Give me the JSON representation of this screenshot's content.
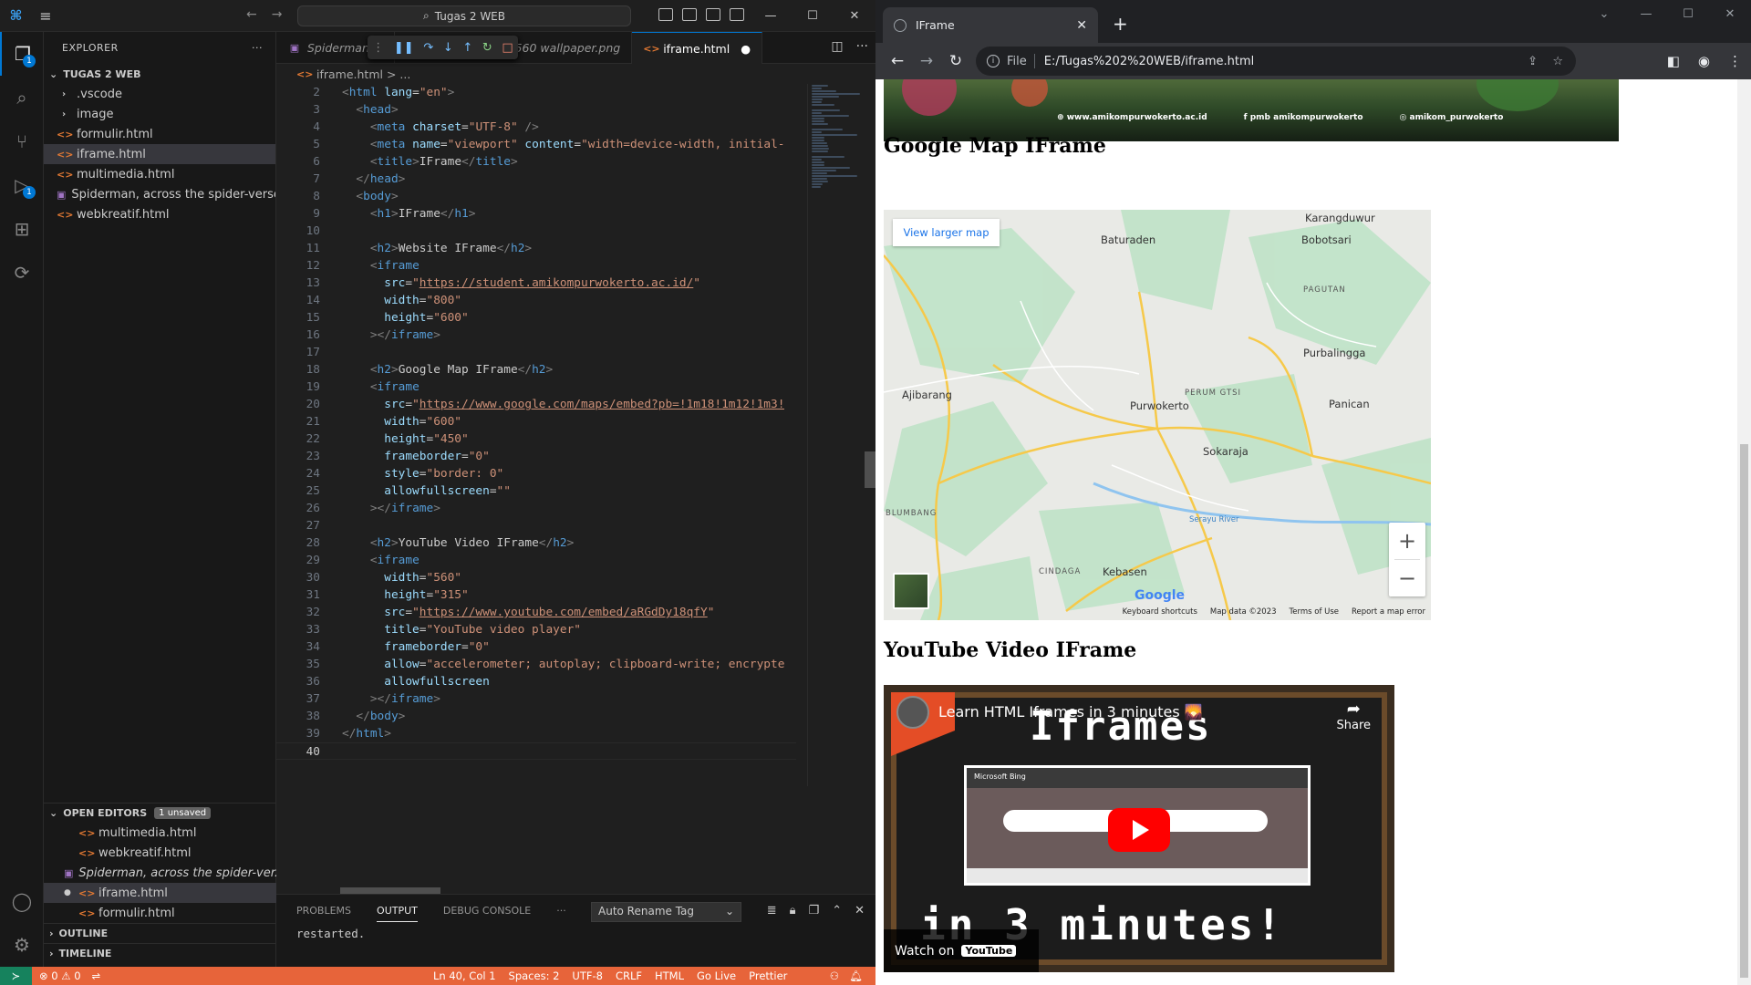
{
  "vscode": {
    "search": "Tugas 2 WEB",
    "explorer_title": "EXPLORER",
    "folder": "TUGAS 2 WEB",
    "files": [
      {
        "name": ".vscode",
        "type": "folder"
      },
      {
        "name": "image",
        "type": "folder"
      },
      {
        "name": "formulir.html",
        "type": "html"
      },
      {
        "name": "iframe.html",
        "type": "html"
      },
      {
        "name": "multimedia.html",
        "type": "html"
      },
      {
        "name": "Spiderman, across the spider-verse,...",
        "type": "png"
      },
      {
        "name": "webkreatif.html",
        "type": "html"
      }
    ],
    "open_editors": {
      "title": "OPEN EDITORS",
      "badge": "1 unsaved",
      "items": [
        "multimedia.html",
        "webkreatif.html",
        "Spiderman, across the spider-ver...",
        "iframe.html",
        "formulir.html"
      ]
    },
    "outline": "OUTLINE",
    "timeline": "TIMELINE",
    "tabs": [
      {
        "label": "Spiderman, a"
      },
      {
        "label": "rale, 1440x2560 wallpaper.png"
      },
      {
        "label": "iframe.html"
      }
    ],
    "breadcrumb": "iframe.html > ...",
    "code_lines": [
      {
        "n": "2",
        "html": "<span class='t-br'>&lt;</span><span class='t-tag'>html</span> <span class='t-attr'>lang</span>=<span class='t-str'>\"en\"</span><span class='t-br'>&gt;</span>"
      },
      {
        "n": "3",
        "html": "  <span class='t-br'>&lt;</span><span class='t-tag'>head</span><span class='t-br'>&gt;</span>"
      },
      {
        "n": "4",
        "html": "    <span class='t-br'>&lt;</span><span class='t-tag'>meta</span> <span class='t-attr'>charset</span>=<span class='t-str'>\"UTF-8\"</span> <span class='t-br'>/&gt;</span>"
      },
      {
        "n": "5",
        "html": "    <span class='t-br'>&lt;</span><span class='t-tag'>meta</span> <span class='t-attr'>name</span>=<span class='t-str'>\"viewport\"</span> <span class='t-attr'>content</span>=<span class='t-str'>\"width=device-width, initial-</span>"
      },
      {
        "n": "6",
        "html": "    <span class='t-br'>&lt;</span><span class='t-tag'>title</span><span class='t-br'>&gt;</span>IFrame<span class='t-br'>&lt;/</span><span class='t-tag'>title</span><span class='t-br'>&gt;</span>"
      },
      {
        "n": "7",
        "html": "  <span class='t-br'>&lt;/</span><span class='t-tag'>head</span><span class='t-br'>&gt;</span>"
      },
      {
        "n": "8",
        "html": "  <span class='t-br'>&lt;</span><span class='t-tag'>body</span><span class='t-br'>&gt;</span>"
      },
      {
        "n": "9",
        "html": "    <span class='t-br'>&lt;</span><span class='t-tag'>h1</span><span class='t-br'>&gt;</span>IFrame<span class='t-br'>&lt;/</span><span class='t-tag'>h1</span><span class='t-br'>&gt;</span>"
      },
      {
        "n": "10",
        "html": ""
      },
      {
        "n": "11",
        "html": "    <span class='t-br'>&lt;</span><span class='t-tag'>h2</span><span class='t-br'>&gt;</span>Website IFrame<span class='t-br'>&lt;/</span><span class='t-tag'>h2</span><span class='t-br'>&gt;</span>"
      },
      {
        "n": "12",
        "html": "    <span class='t-br'>&lt;</span><span class='t-tag'>iframe</span>"
      },
      {
        "n": "13",
        "html": "      <span class='t-attr'>src</span>=<span class='t-str'>\"</span><span class='t-url'>https://student.amikompurwokerto.ac.id/</span><span class='t-str'>\"</span>"
      },
      {
        "n": "14",
        "html": "      <span class='t-attr'>width</span>=<span class='t-str'>\"800\"</span>"
      },
      {
        "n": "15",
        "html": "      <span class='t-attr'>height</span>=<span class='t-str'>\"600\"</span>"
      },
      {
        "n": "16",
        "html": "    <span class='t-br'>&gt;&lt;/</span><span class='t-tag'>iframe</span><span class='t-br'>&gt;</span>"
      },
      {
        "n": "17",
        "html": ""
      },
      {
        "n": "18",
        "html": "    <span class='t-br'>&lt;</span><span class='t-tag'>h2</span><span class='t-br'>&gt;</span>Google Map IFrame<span class='t-br'>&lt;/</span><span class='t-tag'>h2</span><span class='t-br'>&gt;</span>"
      },
      {
        "n": "19",
        "html": "    <span class='t-br'>&lt;</span><span class='t-tag'>iframe</span>"
      },
      {
        "n": "20",
        "html": "      <span class='t-attr'>src</span>=<span class='t-str'>\"</span><span class='t-url'>https://www.google.com/maps/embed?pb=!1m18!1m12!1m3!</span>"
      },
      {
        "n": "21",
        "html": "      <span class='t-attr'>width</span>=<span class='t-str'>\"600\"</span>"
      },
      {
        "n": "22",
        "html": "      <span class='t-attr'>height</span>=<span class='t-str'>\"450\"</span>"
      },
      {
        "n": "23",
        "html": "      <span class='t-attr'>frameborder</span>=<span class='t-str'>\"0\"</span>"
      },
      {
        "n": "24",
        "html": "      <span class='t-attr'>style</span>=<span class='t-str'>\"border: 0\"</span>"
      },
      {
        "n": "25",
        "html": "      <span class='t-attr'>allowfullscreen</span>=<span class='t-str'>\"\"</span>"
      },
      {
        "n": "26",
        "html": "    <span class='t-br'>&gt;&lt;/</span><span class='t-tag'>iframe</span><span class='t-br'>&gt;</span>"
      },
      {
        "n": "27",
        "html": ""
      },
      {
        "n": "28",
        "html": "    <span class='t-br'>&lt;</span><span class='t-tag'>h2</span><span class='t-br'>&gt;</span>YouTube Video IFrame<span class='t-br'>&lt;/</span><span class='t-tag'>h2</span><span class='t-br'>&gt;</span>"
      },
      {
        "n": "29",
        "html": "    <span class='t-br'>&lt;</span><span class='t-tag'>iframe</span>"
      },
      {
        "n": "30",
        "html": "      <span class='t-attr'>width</span>=<span class='t-str'>\"560\"</span>"
      },
      {
        "n": "31",
        "html": "      <span class='t-attr'>height</span>=<span class='t-str'>\"315\"</span>"
      },
      {
        "n": "32",
        "html": "      <span class='t-attr'>src</span>=<span class='t-str'>\"</span><span class='t-url'>https://www.youtube.com/embed/aRGdDy18qfY</span><span class='t-str'>\"</span>"
      },
      {
        "n": "33",
        "html": "      <span class='t-attr'>title</span>=<span class='t-str'>\"YouTube video player\"</span>"
      },
      {
        "n": "34",
        "html": "      <span class='t-attr'>frameborder</span>=<span class='t-str'>\"0\"</span>"
      },
      {
        "n": "35",
        "html": "      <span class='t-attr'>allow</span>=<span class='t-str'>\"accelerometer; autoplay; clipboard-write; encrypte</span>"
      },
      {
        "n": "36",
        "html": "      <span class='t-attr'>allowfullscreen</span>"
      },
      {
        "n": "37",
        "html": "    <span class='t-br'>&gt;&lt;/</span><span class='t-tag'>iframe</span><span class='t-br'>&gt;</span>"
      },
      {
        "n": "38",
        "html": "  <span class='t-br'>&lt;/</span><span class='t-tag'>body</span><span class='t-br'>&gt;</span>"
      },
      {
        "n": "39",
        "html": "<span class='t-br'>&lt;/</span><span class='t-tag'>html</span><span class='t-br'>&gt;</span>"
      },
      {
        "n": "40",
        "html": ""
      }
    ],
    "panel": {
      "tabs": [
        "PROBLEMS",
        "OUTPUT",
        "DEBUG CONSOLE",
        "···"
      ],
      "select": "Auto Rename Tag",
      "output": "restarted."
    },
    "status": {
      "errors": "⊗ 0 ⚠ 0",
      "items": [
        "Ln 40, Col 1",
        "Spaces: 2",
        "UTF-8",
        "CRLF",
        "HTML",
        "Go Live",
        "Prettier"
      ]
    }
  },
  "chrome": {
    "tab_title": "IFrame",
    "url_prefix": "File",
    "url": "E:/Tugas%202%20WEB/iframe.html",
    "site_footer": [
      "www.amikompurwokerto.ac.id",
      "pmb amikompurwokerto",
      "amikom_purwokerto"
    ],
    "h2_map": "Google Map IFrame",
    "h2_youtube": "YouTube Video IFrame",
    "map": {
      "view_larger": "View larger map",
      "places": [
        "Karangduwur",
        "Baturaden",
        "Bobotsari",
        "PAGUTAN",
        "Purbalingga",
        "Ajibarang",
        "PERUM GTSI",
        "Purwokerto",
        "Panican",
        "Sokaraja",
        "BLUMBANG",
        "Serayu River",
        "CINDAGA",
        "Kebasen"
      ],
      "google": "Google",
      "attribution": [
        "Keyboard shortcuts",
        "Map data ©2023",
        "Terms of Use",
        "Report a map error"
      ]
    },
    "youtube": {
      "title": "Learn HTML Iframes in 3 minutes 🌄",
      "share": "Share",
      "big_text": "Iframes",
      "bottom_text": "in 3 minutes!",
      "watch_on": "Watch on",
      "brand": "YouTube",
      "bing": "Microsoft Bing"
    }
  }
}
